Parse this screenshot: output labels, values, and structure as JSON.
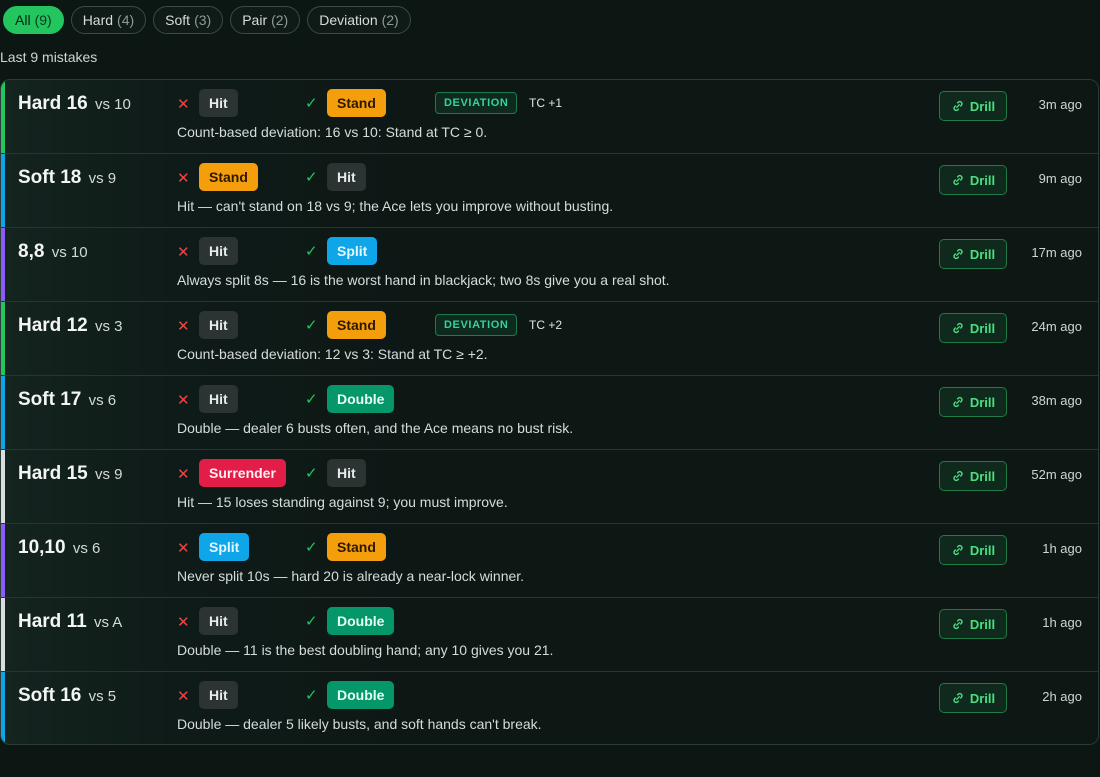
{
  "filters": [
    {
      "label": "All",
      "count": "(9)",
      "active": true
    },
    {
      "label": "Hard",
      "count": "(4)",
      "active": false
    },
    {
      "label": "Soft",
      "count": "(3)",
      "active": false
    },
    {
      "label": "Pair",
      "count": "(2)",
      "active": false
    },
    {
      "label": "Deviation",
      "count": "(2)",
      "active": false
    }
  ],
  "subtitle": "Last 9 mistakes",
  "colors": {
    "hard": "#22c55e",
    "soft": "#0ea5e9",
    "pair": "#8b5cf6",
    "plain": "#d9dedc"
  },
  "drill_label": "Drill",
  "deviation_label": "DEVIATION",
  "mistakes": [
    {
      "category": "hard",
      "hand": "Hard 16",
      "vs": "vs 10",
      "your_action": "Hit",
      "correct_action": "Stand",
      "deviation": true,
      "tc": "TC +1",
      "description": "Count-based deviation: 16 vs 10: Stand at TC ≥ 0.",
      "time": "3m ago"
    },
    {
      "category": "soft",
      "hand": "Soft 18",
      "vs": "vs 9",
      "your_action": "Stand",
      "correct_action": "Hit",
      "deviation": false,
      "tc": "",
      "description": "Hit — can't stand on 18 vs 9; the Ace lets you improve without busting.",
      "time": "9m ago"
    },
    {
      "category": "pair",
      "hand": "8,8",
      "vs": "vs 10",
      "your_action": "Hit",
      "correct_action": "Split",
      "deviation": false,
      "tc": "",
      "description": "Always split 8s — 16 is the worst hand in blackjack; two 8s give you a real shot.",
      "time": "17m ago"
    },
    {
      "category": "hard",
      "hand": "Hard 12",
      "vs": "vs 3",
      "your_action": "Hit",
      "correct_action": "Stand",
      "deviation": true,
      "tc": "TC +2",
      "description": "Count-based deviation: 12 vs 3: Stand at TC ≥ +2.",
      "time": "24m ago"
    },
    {
      "category": "soft",
      "hand": "Soft 17",
      "vs": "vs 6",
      "your_action": "Hit",
      "correct_action": "Double",
      "deviation": false,
      "tc": "",
      "description": "Double — dealer 6 busts often, and the Ace means no bust risk.",
      "time": "38m ago"
    },
    {
      "category": "plain",
      "hand": "Hard 15",
      "vs": "vs 9",
      "your_action": "Surrender",
      "correct_action": "Hit",
      "deviation": false,
      "tc": "",
      "description": "Hit — 15 loses standing against 9; you must improve.",
      "time": "52m ago"
    },
    {
      "category": "pair",
      "hand": "10,10",
      "vs": "vs 6",
      "your_action": "Split",
      "correct_action": "Stand",
      "deviation": false,
      "tc": "",
      "description": "Never split 10s — hard 20 is already a near-lock winner.",
      "time": "1h ago"
    },
    {
      "category": "plain",
      "hand": "Hard 11",
      "vs": "vs A",
      "your_action": "Hit",
      "correct_action": "Double",
      "deviation": false,
      "tc": "",
      "description": "Double — 11 is the best doubling hand; any 10 gives you 21.",
      "time": "1h ago"
    },
    {
      "category": "soft",
      "hand": "Soft 16",
      "vs": "vs 5",
      "your_action": "Hit",
      "correct_action": "Double",
      "deviation": false,
      "tc": "",
      "description": "Double — dealer 5 likely busts, and soft hands can't break.",
      "time": "2h ago"
    }
  ]
}
